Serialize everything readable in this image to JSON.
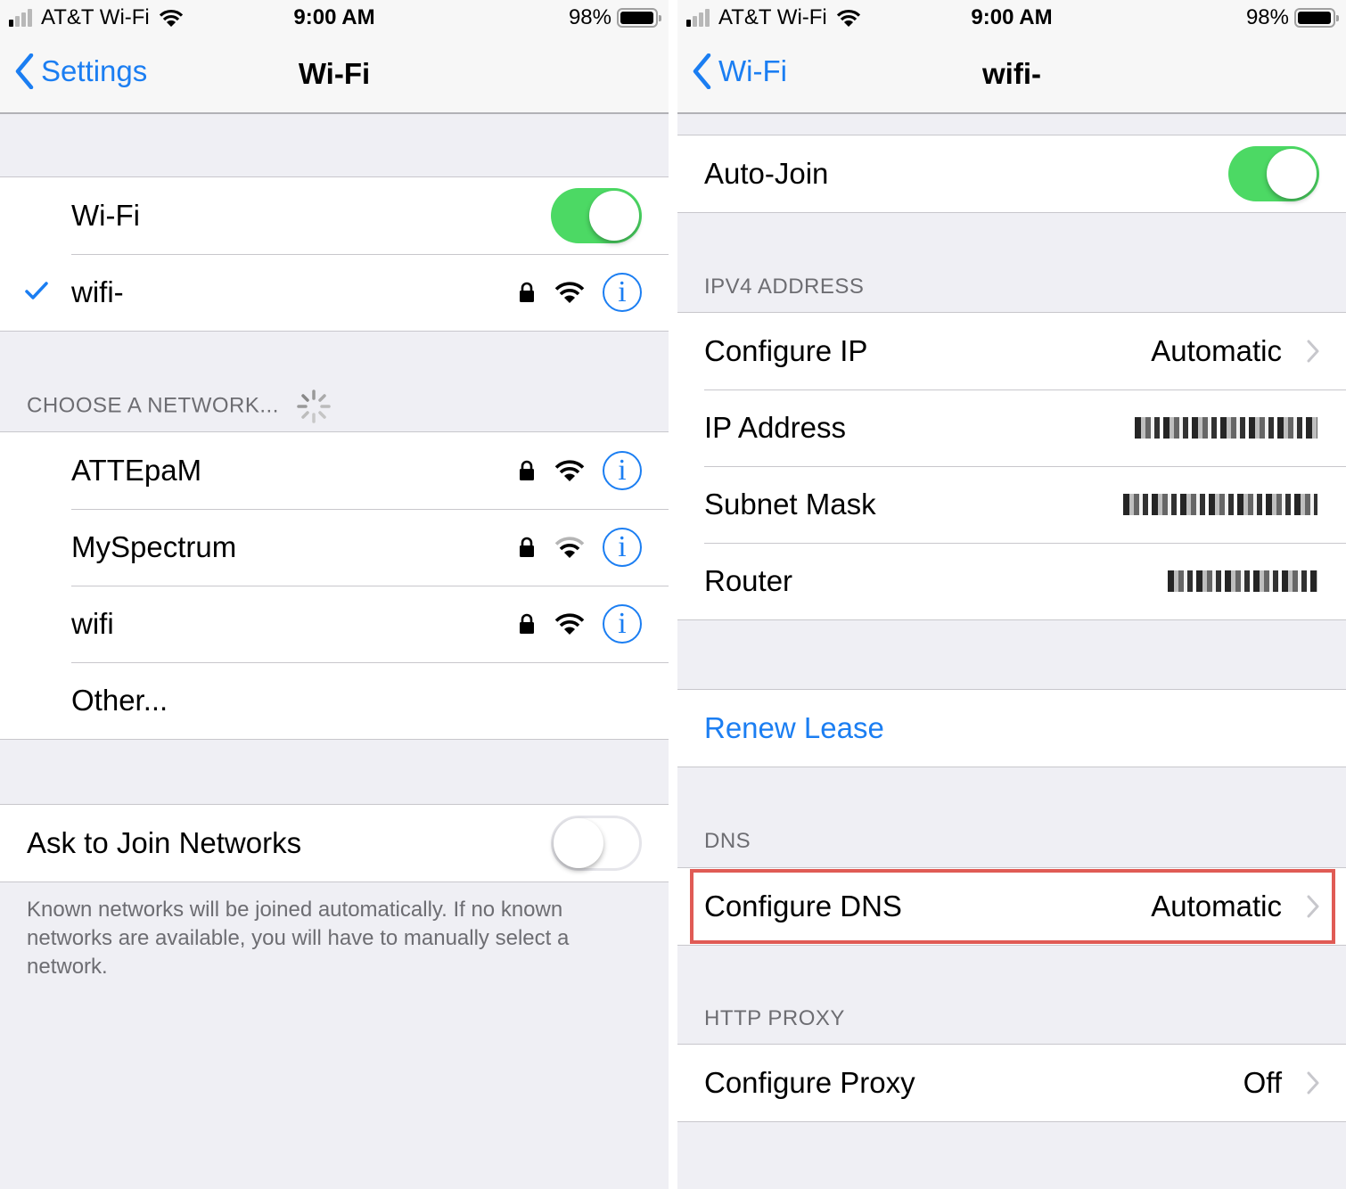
{
  "status_bar": {
    "carrier": "AT&T Wi-Fi",
    "time": "9:00 AM",
    "battery_percent": "98%",
    "battery_level": 0.98,
    "signal_bars_filled": 1,
    "signal_bars_total": 4
  },
  "left_screen": {
    "nav": {
      "back_label": "Settings",
      "title": "Wi-Fi"
    },
    "wifi_toggle": {
      "label": "Wi-Fi",
      "on": true
    },
    "connected_network": {
      "name": "wifi-",
      "selected": true,
      "locked": true,
      "signal_bars": 3
    },
    "networks_header": "CHOOSE A NETWORK...",
    "networks": [
      {
        "name": "ATTEpaM",
        "locked": true,
        "signal_bars": 3
      },
      {
        "name": "MySpectrum",
        "locked": true,
        "signal_bars": 2
      },
      {
        "name": "wifi",
        "locked": true,
        "signal_bars": 3
      }
    ],
    "other_label": "Other...",
    "ask_to_join": {
      "label": "Ask to Join Networks",
      "on": false
    },
    "ask_to_join_footer": "Known networks will be joined automatically. If no known networks are available, you will have to manually select a network."
  },
  "right_screen": {
    "nav": {
      "back_label": "Wi-Fi",
      "title": "wifi-"
    },
    "auto_join": {
      "label": "Auto-Join",
      "on": true
    },
    "ipv4_header": "IPV4 ADDRESS",
    "ipv4_rows": [
      {
        "label": "Configure IP",
        "value": "Automatic",
        "chevron": true,
        "obscured": false
      },
      {
        "label": "IP Address",
        "value": "",
        "chevron": false,
        "obscured": true
      },
      {
        "label": "Subnet Mask",
        "value": "",
        "chevron": false,
        "obscured": true
      },
      {
        "label": "Router",
        "value": "",
        "chevron": false,
        "obscured": true
      }
    ],
    "renew_lease": "Renew Lease",
    "dns_header": "DNS",
    "configure_dns": {
      "label": "Configure DNS",
      "value": "Automatic",
      "highlighted": true
    },
    "proxy_header": "HTTP PROXY",
    "configure_proxy": {
      "label": "Configure Proxy",
      "value": "Off"
    }
  },
  "colors": {
    "accent": "#1b7ef2",
    "toggle_on": "#4cd964",
    "highlight_box": "#e05b55",
    "grouped_bg": "#efeff4"
  }
}
